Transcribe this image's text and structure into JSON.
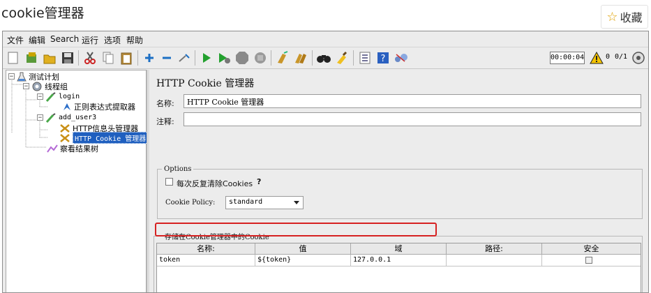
{
  "article": {
    "title": "cookie管理器",
    "favorite_label": "收藏"
  },
  "menubar": {
    "items": [
      "文件",
      "编辑",
      "Search",
      "运行",
      "选项",
      "帮助"
    ]
  },
  "toolbar": {
    "icons": [
      "new-icon",
      "templates-icon",
      "open-icon",
      "save-icon",
      "cut-icon",
      "copy-icon",
      "paste-icon",
      "expand-icon",
      "collapse-icon",
      "toggle-icon",
      "start-icon",
      "start-no-timers-icon",
      "stop-icon",
      "shutdown-icon",
      "clear-icon",
      "clear-all-icon",
      "search-icon",
      "reset-search-icon",
      "function-helper-icon",
      "help-icon",
      "remote-icon"
    ],
    "elapsed": "00:00:04",
    "warnings": "0",
    "threads": "0/1"
  },
  "tree": {
    "items": [
      {
        "label": "测试计划"
      },
      {
        "label": "线程组"
      },
      {
        "label": "login"
      },
      {
        "label": "正则表达式提取器"
      },
      {
        "label": "add_user3"
      },
      {
        "label": "HTTP信息头管理器"
      },
      {
        "label": "HTTP Cookie 管理器"
      },
      {
        "label": "察看结果树"
      }
    ]
  },
  "panel": {
    "title": "HTTP Cookie 管理器",
    "name_label": "名称:",
    "name_value": "HTTP Cookie 管理器",
    "comment_label": "注释:",
    "comment_value": "",
    "options_legend": "Options",
    "clear_each_label": "每次反复清除Cookies",
    "help_mark": "?",
    "policy_label": "Cookie Policy:",
    "policy_value": "standard",
    "stored_legend": "存储在Cookie管理器中的Cookie"
  },
  "cookie_table": {
    "columns": [
      "名称:",
      "值",
      "域",
      "路径:",
      "安全"
    ],
    "rows": [
      {
        "name": "token",
        "value": "${token}",
        "domain": "127.0.0.1",
        "path": "",
        "secure": false
      }
    ]
  }
}
